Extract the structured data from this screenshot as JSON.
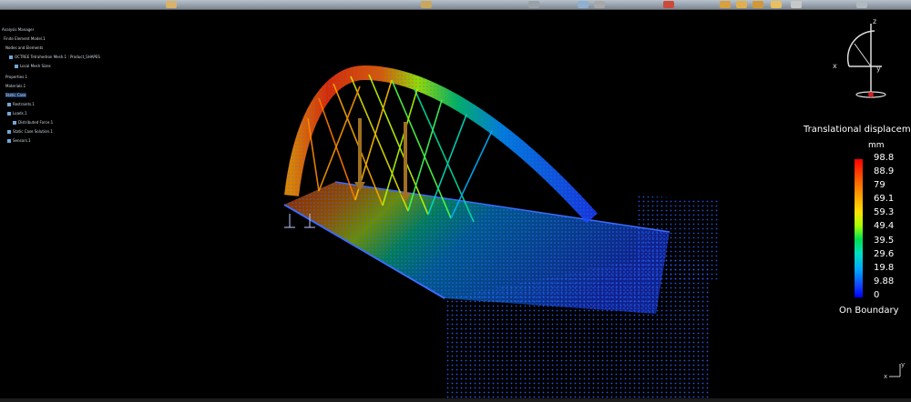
{
  "specification_tree": {
    "items": [
      {
        "label": "Analysis Manager"
      },
      {
        "label": "Finite Element Model.1"
      },
      {
        "label": "Nodes and Elements"
      },
      {
        "label": "OCTREE Tetrahedron Mesh.1 : Product_SHAPES"
      },
      {
        "label": "Local Mesh Sizes"
      },
      {
        "label": "Properties.1"
      },
      {
        "label": "Materials.1"
      },
      {
        "label": "Static Case"
      },
      {
        "label": "Restraints.1"
      },
      {
        "label": "Loads.1"
      },
      {
        "label": "Distributed Force.1"
      },
      {
        "label": "Static Case Solution.1"
      },
      {
        "label": "Sensors.1"
      }
    ]
  },
  "legend": {
    "title": "Translational displacemer",
    "unit": "mm",
    "values": [
      "98.8",
      "88.9",
      "79",
      "69.1",
      "59.3",
      "49.4",
      "39.5",
      "29.6",
      "19.8",
      "9.88",
      "0"
    ],
    "footer": "On Boundary"
  },
  "compass": {
    "x_label": "x",
    "y_label": "y",
    "z_label": "z"
  },
  "axis_mini": {
    "x_label": "x",
    "y_label": "y"
  },
  "colors": {
    "background": "#000000",
    "mesh_low": "#1a40ff",
    "mesh_high": "#ff2000"
  }
}
